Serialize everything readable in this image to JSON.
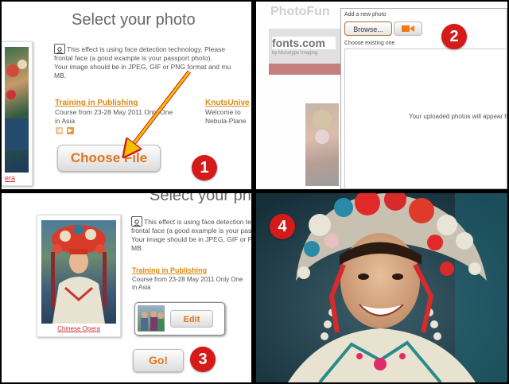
{
  "steps": [
    "1",
    "2",
    "3",
    "4"
  ],
  "panel1": {
    "title": "Select your photo",
    "info_lines": [
      "This effect is using face detection technology. Please",
      "frontal face (a good example is your passport photo).",
      "Your image should be in JPEG, GIF or PNG format and mu",
      "MB."
    ],
    "course_title": "Training in Publishing",
    "course_text": [
      "Course from 23-28 May 2011 Only One",
      "in Asia"
    ],
    "course2_title": "KnutsUnive",
    "course2_text": [
      "Welcome to",
      "Nebula-Plane"
    ],
    "photo_caption_partial": "era",
    "choose_file_label": "Choose File"
  },
  "panel2": {
    "logo_text": "PhotoFun",
    "ad_text": "fonts.com",
    "ad_sub": "by Monotype Imaging",
    "add_new_label": "Add a new photo",
    "browse_label": "Browse...",
    "choose_existing_label": "Choose existing one",
    "empty_message": "Your uploaded photos will appear h"
  },
  "panel3": {
    "title": "Select your photo",
    "info_lines": [
      "This effect is using face detection techn",
      "frontal face (a good example is your pass",
      "Your image should be in JPEG, GIF or PNG",
      "MB."
    ],
    "course_title": "Training in Publishing",
    "course_text": [
      "Course from 23-28 May 2011 Only One",
      "in Asia"
    ],
    "photo_caption": "Chinese Opera",
    "edit_label": "Edit",
    "go_label": "Go!"
  },
  "colors": {
    "badge": "#d51a1a",
    "choose_file_text": "#e0761f",
    "link": "#d98a14",
    "arrow": "#f2c200"
  }
}
